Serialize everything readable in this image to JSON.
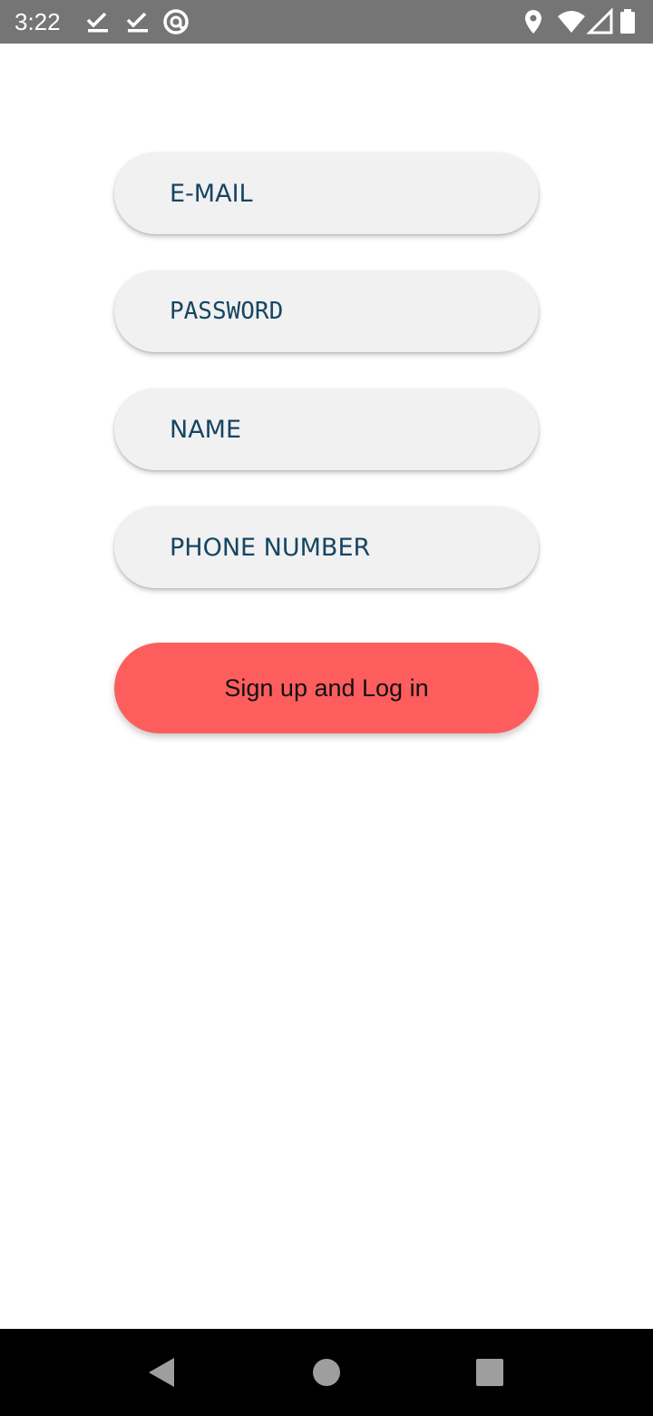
{
  "status_bar": {
    "time": "3:22",
    "left_icons": [
      "check-download-icon",
      "check-download-icon",
      "at-sign-icon"
    ],
    "right_icons": [
      "location-icon",
      "wifi-icon",
      "signal-icon",
      "battery-icon"
    ]
  },
  "form": {
    "email": {
      "placeholder": "E-MAIL",
      "value": ""
    },
    "password": {
      "placeholder": "PASSWORD",
      "value": ""
    },
    "name": {
      "placeholder": "NAME",
      "value": ""
    },
    "phone": {
      "placeholder": "PHONE NUMBER",
      "value": ""
    },
    "submit_label": "Sign up and Log in"
  },
  "nav_bar": {
    "buttons": [
      "back-icon",
      "home-icon",
      "recents-icon"
    ]
  },
  "colors": {
    "status_bar": "#757575",
    "field_bg": "#f1f1f1",
    "placeholder_text": "#154563",
    "button_accent": "#fe5d5e",
    "nav_bar": "#000000"
  }
}
